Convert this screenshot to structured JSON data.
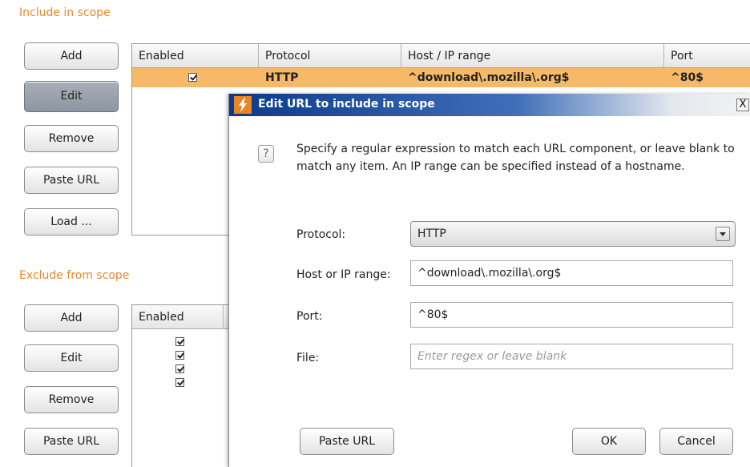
{
  "include_scope": {
    "title": "Include in scope",
    "buttons": {
      "add": "Add",
      "edit": "Edit",
      "remove": "Remove",
      "paste_url": "Paste URL",
      "load": "Load ..."
    },
    "columns": [
      "Enabled",
      "Protocol",
      "Host / IP range",
      "Port"
    ],
    "rows": [
      {
        "enabled": true,
        "protocol": "HTTP",
        "host": "^download\\.mozilla\\.org$",
        "port": "^80$",
        "selected": true
      }
    ]
  },
  "exclude_scope": {
    "title": "Exclude from scope",
    "buttons": {
      "add": "Add",
      "edit": "Edit",
      "remove": "Remove",
      "paste_url": "Paste URL"
    },
    "columns": [
      "Enabled"
    ],
    "rows": [
      {
        "enabled": true
      },
      {
        "enabled": true
      },
      {
        "enabled": true
      },
      {
        "enabled": true
      }
    ]
  },
  "dialog": {
    "title": "Edit URL to include in scope",
    "close_label": "X",
    "help_glyph": "?",
    "description": "Specify a regular expression to match each URL component, or leave blank to match any item. An IP range can be specified instead of a hostname.",
    "protocol_label": "Protocol:",
    "protocol_value": "HTTP",
    "host_label": "Host or IP range:",
    "host_value": "^download\\.mozilla\\.org$",
    "port_label": "Port:",
    "port_value": "^80$",
    "file_label": "File:",
    "file_value": "",
    "file_placeholder": "Enter regex or leave blank",
    "paste_url": "Paste URL",
    "ok": "OK",
    "cancel": "Cancel"
  },
  "colors": {
    "section_title": "#e8882a",
    "selected_row": "#f6b968",
    "titlebar": "#0b3a8a"
  }
}
